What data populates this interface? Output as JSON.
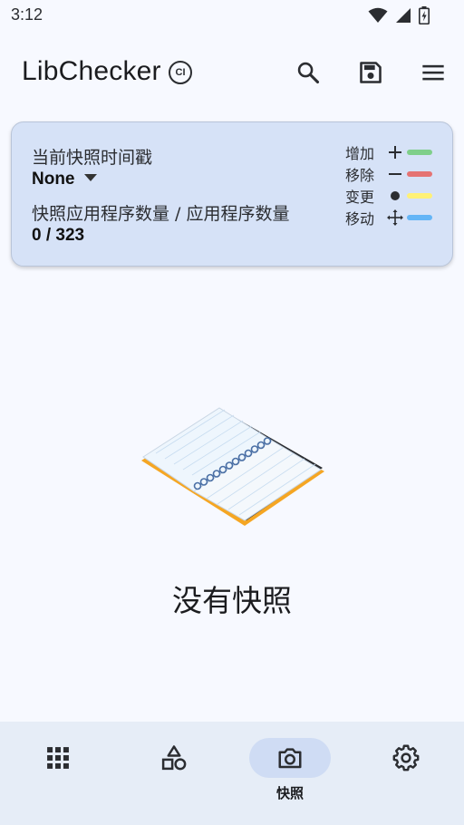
{
  "status_bar": {
    "time": "3:12",
    "icons": [
      "wifi-icon",
      "signal-icon",
      "battery-icon"
    ]
  },
  "app_bar": {
    "title": "LibChecker",
    "badge": "CI",
    "actions": [
      "search-icon",
      "save-icon",
      "menu-icon"
    ]
  },
  "card": {
    "timestamp_label": "当前快照时间戳",
    "timestamp_value": "None",
    "count_label": "快照应用程序数量 / 应用程序数量",
    "count_value": "0 / 323",
    "legend": [
      {
        "label": "增加",
        "symbol": "+",
        "color": "#7fcf8a"
      },
      {
        "label": "移除",
        "symbol": "−",
        "color": "#e57373"
      },
      {
        "label": "变更",
        "symbol": "●",
        "color": "#fff176"
      },
      {
        "label": "移动",
        "symbol": "✥",
        "color": "#64b5f6"
      }
    ]
  },
  "empty_state": {
    "message": "没有快照"
  },
  "bottom_nav": {
    "items": [
      {
        "icon": "apps-grid-icon",
        "label": ""
      },
      {
        "icon": "shapes-icon",
        "label": ""
      },
      {
        "icon": "camera-icon",
        "label": "快照",
        "active": true
      },
      {
        "icon": "gear-icon",
        "label": ""
      }
    ]
  },
  "colors": {
    "background": "#f7f9ff",
    "card": "#d6e2f7",
    "bottom_nav": "#e6edf7",
    "active_indicator": "#cfdcf4"
  }
}
